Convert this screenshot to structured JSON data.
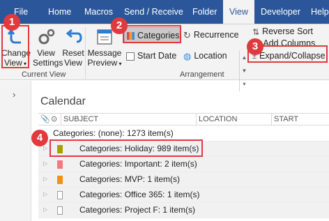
{
  "ribbon_tabs": [
    "File",
    "Home",
    "Macros",
    "Send / Receive",
    "Folder",
    "View",
    "Developer",
    "Help"
  ],
  "active_tab": "View",
  "current_view_group": {
    "label": "Current View",
    "change_view": [
      "Change",
      "View"
    ],
    "view_settings": [
      "View",
      "Settings"
    ],
    "reset_view": [
      "Reset",
      "View"
    ]
  },
  "arrangement_group": {
    "label": "Arrangement",
    "message_preview": [
      "Message",
      "Preview"
    ],
    "categories": "Categories",
    "start_date": "Start Date",
    "recurrence": "Recurrence",
    "location": "Location"
  },
  "right_commands": {
    "reverse_sort": "Reverse Sort",
    "add_columns": "Add Columns",
    "expand_collapse": "Expand/Collapse"
  },
  "main": {
    "title": "Calendar",
    "columns": [
      "SUBJECT",
      "LOCATION",
      "START"
    ]
  },
  "groups": [
    {
      "label": "Categories: (none): 1273 item(s)",
      "color": ""
    },
    {
      "label": "Categories: Holiday: 989 item(s)",
      "color": "#a8a000"
    },
    {
      "label": "Categories: Important: 2 item(s)",
      "color": "#f07a80"
    },
    {
      "label": "Categories: MVP: 1 item(s)",
      "color": "#f39016"
    },
    {
      "label": "Categories: Office 365: 1 item(s)",
      "color": ""
    },
    {
      "label": "Categories: Project F: 1 item(s)",
      "color": ""
    }
  ],
  "callouts": [
    "1",
    "2",
    "3",
    "4"
  ],
  "colors": {
    "ribbon_blue": "#2b579a",
    "callout_red": "#e03a3e"
  }
}
